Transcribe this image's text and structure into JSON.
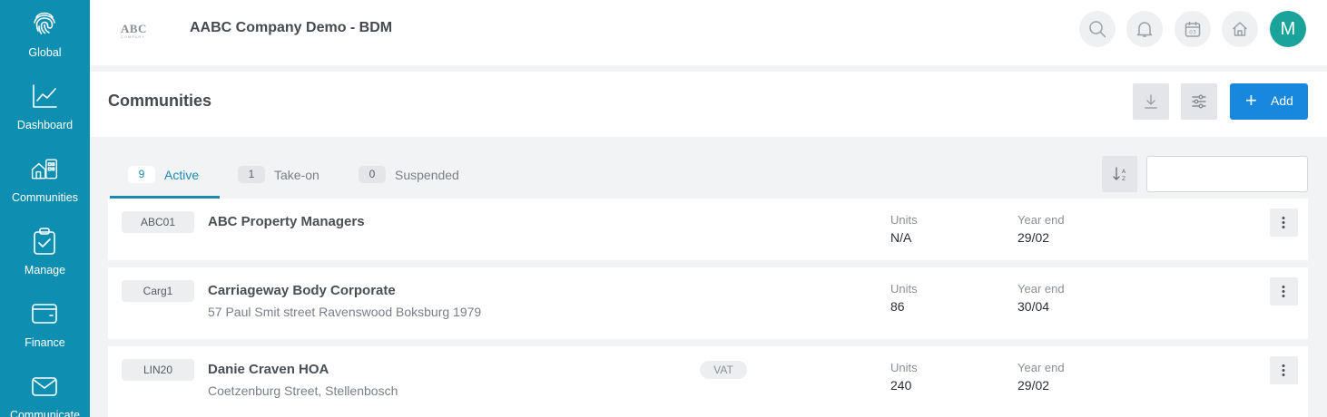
{
  "sidebar": {
    "items": [
      {
        "label": "Global",
        "icon": "fingerprint-icon"
      },
      {
        "label": "Dashboard",
        "icon": "line-chart-icon"
      },
      {
        "label": "Communities",
        "icon": "buildings-icon"
      },
      {
        "label": "Manage",
        "icon": "clipboard-check-icon"
      },
      {
        "label": "Finance",
        "icon": "wallet-icon"
      },
      {
        "label": "Communicate",
        "icon": "envelope-icon"
      }
    ]
  },
  "header": {
    "logo_text": "ABC",
    "logo_subtext": "COMPANY",
    "company_name": "AABC Company Demo - BDM",
    "avatar_initial": "M",
    "icons": [
      "search-icon",
      "bell-icon",
      "calendar-icon",
      "home-icon"
    ],
    "calendar_day": "03"
  },
  "page": {
    "title": "Communities",
    "add_label": "Add"
  },
  "tabs": [
    {
      "count": "9",
      "label": "Active",
      "active": true
    },
    {
      "count": "1",
      "label": "Take-on",
      "active": false
    },
    {
      "count": "0",
      "label": "Suspended",
      "active": false
    }
  ],
  "search": {
    "value": "",
    "placeholder": ""
  },
  "communities": [
    {
      "code": "ABC01",
      "name": "ABC Property Managers",
      "address": "",
      "vat": "",
      "units_label": "Units",
      "units": "N/A",
      "year_end_label": "Year end",
      "year_end": "29/02"
    },
    {
      "code": "Carg1",
      "name": "Carriageway Body Corporate",
      "address": "57 Paul Smit street Ravenswood Boksburg 1979",
      "vat": "",
      "units_label": "Units",
      "units": "86",
      "year_end_label": "Year end",
      "year_end": "30/04"
    },
    {
      "code": "LIN20",
      "name": "Danie Craven HOA",
      "address": "Coetzenburg Street, Stellenbosch",
      "vat": "VAT",
      "units_label": "Units",
      "units": "240",
      "year_end_label": "Year end",
      "year_end": "29/02"
    }
  ],
  "colors": {
    "sidebar": "#0e8eb0",
    "accent": "#1b8ab0",
    "add_button": "#1788dd",
    "avatar": "#1aa39a"
  }
}
